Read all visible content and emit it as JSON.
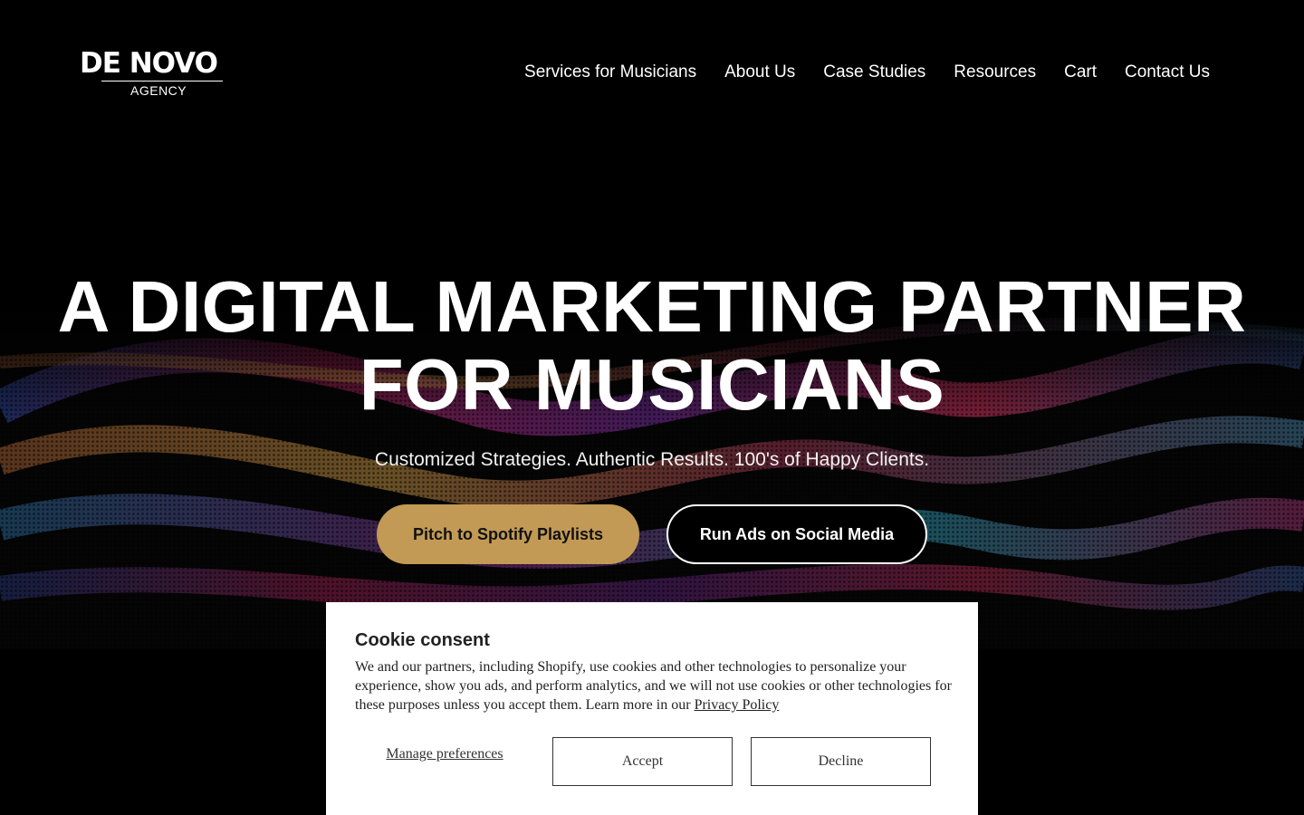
{
  "header": {
    "logo_main": "DE NOVO",
    "logo_sub": "AGENCY",
    "nav": [
      {
        "label": "Services for Musicians"
      },
      {
        "label": "About Us"
      },
      {
        "label": "Case Studies"
      },
      {
        "label": "Resources"
      },
      {
        "label": "Cart"
      },
      {
        "label": "Contact Us"
      }
    ]
  },
  "hero": {
    "headline_line1": "A DIGITAL MARKETING PARTNER",
    "headline_line2": "FOR MUSICIANS",
    "subline": "Customized Strategies. Authentic Results. 100's of Happy Clients.",
    "primary_button": "Pitch to Spotify Playlists",
    "secondary_button": "Run Ads on Social Media",
    "background": "sound-wave-particles-image"
  },
  "cookie": {
    "title": "Cookie consent",
    "text": "We and our partners, including Shopify, use cookies and other technologies to personalize your experience, show you ads, and perform analytics, and we will not use cookies or other technologies for these purposes unless you accept them. Learn more in our",
    "link": "Privacy Policy",
    "manage": "Manage preferences",
    "accept": "Accept",
    "decline": "Decline"
  },
  "colors": {
    "background": "#000000",
    "accent_gold": "#c29a55",
    "text": "#ffffff",
    "cookie_bg": "#ffffff"
  }
}
